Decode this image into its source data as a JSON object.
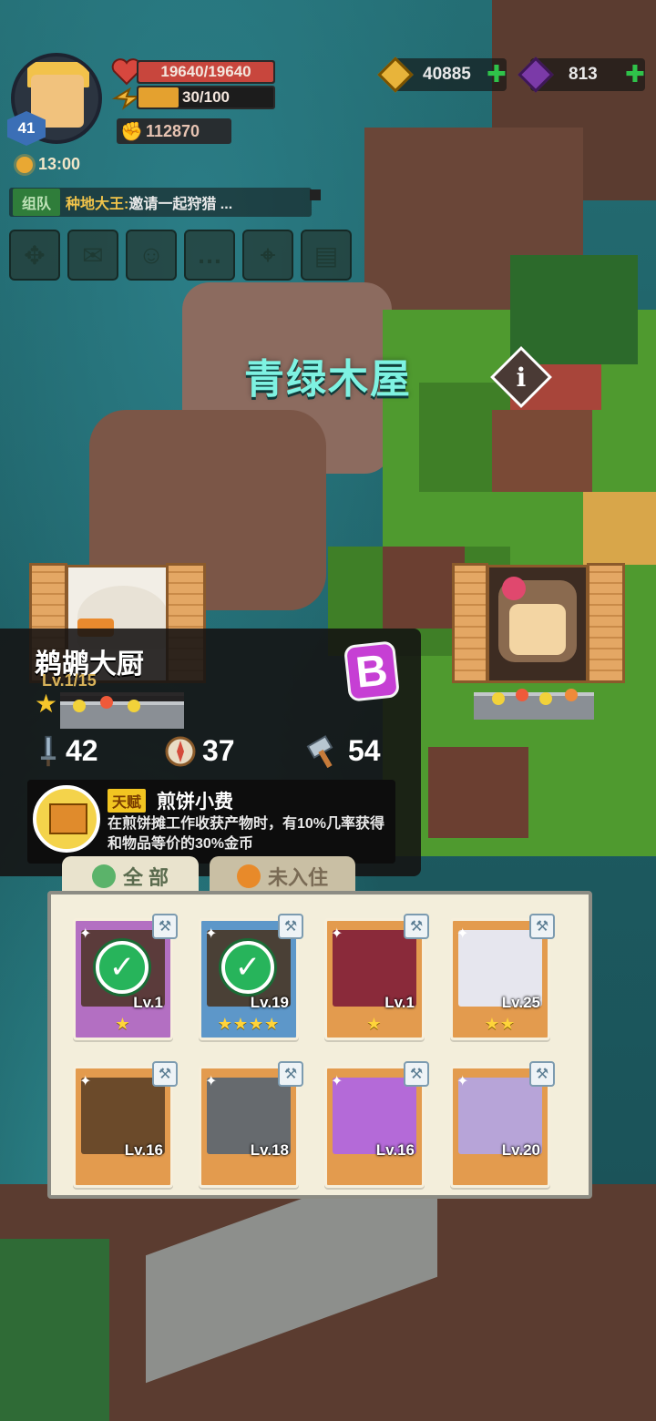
{
  "hud": {
    "player_level": "41",
    "hp_text": "19640/19640",
    "hp_fraction": 1.0,
    "stamina_text": "30/100",
    "stamina_fraction": 0.3,
    "power": "112870",
    "time": "13:00",
    "gold": "40885",
    "gems": "813",
    "chat": {
      "tag": "组队",
      "name": "种地大王:",
      "message": " 邀请一起狩猎 ..."
    },
    "menu_icons": [
      "map-expand-icon",
      "mail-icon",
      "friends-icon",
      "chat-icon",
      "map-pin-icon",
      "quest-board-icon"
    ]
  },
  "location": {
    "title": "青绿木屋"
  },
  "selected_chef": {
    "name": "鹈鹕大厨",
    "level": "Lv.1/15",
    "stars": "★",
    "grade": "B",
    "stats": {
      "attack": "42",
      "speed": "37",
      "craft": "54"
    },
    "talent": {
      "tag": "天赋",
      "name": "煎饼小费",
      "description": "在煎饼摊工作收获产物时，有10%几率获得和物品等价的30%金币"
    }
  },
  "tabs": [
    "全 部",
    "未入住"
  ],
  "cards": [
    {
      "level": "Lv.1",
      "stars": "★",
      "color": "#b36fc2",
      "checked": true
    },
    {
      "level": "Lv.19",
      "stars": "★★★★",
      "color": "#5d97c9",
      "checked": true
    },
    {
      "level": "Lv.1",
      "stars": "★",
      "color": "#e39b4e",
      "checked": false
    },
    {
      "level": "Lv.25",
      "stars": "★★",
      "color": "#e39b4e",
      "checked": false
    },
    {
      "level": "Lv.16",
      "stars": "",
      "color": "#e39b4e",
      "checked": false
    },
    {
      "level": "Lv.18",
      "stars": "",
      "color": "#e39b4e",
      "checked": false
    },
    {
      "level": "Lv.16",
      "stars": "",
      "color": "#e39b4e",
      "checked": false
    },
    {
      "level": "Lv.20",
      "stars": "",
      "color": "#e39b4e",
      "checked": false
    }
  ]
}
